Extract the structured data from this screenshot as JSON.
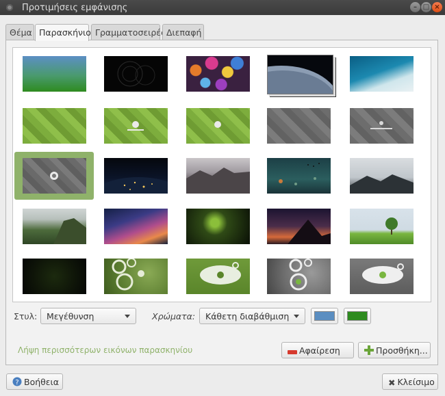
{
  "window": {
    "title": "Προτιμήσεις εμφάνισης",
    "buttons": [
      "minimize",
      "maximize",
      "close"
    ]
  },
  "tabs": [
    {
      "label": "Θέμα",
      "active": false
    },
    {
      "label": "Παρασκήνιο",
      "active": true
    },
    {
      "label": "Γραμματοσειρές",
      "active": false
    },
    {
      "label": "Διεπαφή",
      "active": false
    }
  ],
  "gallery": {
    "selected_index": 10,
    "thumbnails": [
      {
        "name": "blue-green-gradient"
      },
      {
        "name": "dark-circles"
      },
      {
        "name": "bokeh-lights"
      },
      {
        "name": "planet-earth-horizon"
      },
      {
        "name": "ocean-waves-aerial"
      },
      {
        "name": "green-cubes"
      },
      {
        "name": "green-cubes-ubuntu-mate-logo"
      },
      {
        "name": "green-cubes-mate-logo"
      },
      {
        "name": "grey-cubes"
      },
      {
        "name": "grey-cubes-ubuntu-mate-logo"
      },
      {
        "name": "grey-cubes-mate-logo"
      },
      {
        "name": "earth-night-lights"
      },
      {
        "name": "yosemite-valley"
      },
      {
        "name": "rainy-window-birds"
      },
      {
        "name": "misty-mountain"
      },
      {
        "name": "green-highlands"
      },
      {
        "name": "milky-way-lake"
      },
      {
        "name": "green-abstract-swirl"
      },
      {
        "name": "purple-sunset-mountain"
      },
      {
        "name": "lone-tree-field"
      },
      {
        "name": "dark-green-texture"
      },
      {
        "name": "green-circles-left"
      },
      {
        "name": "green-circles-splash"
      },
      {
        "name": "grey-circles-left"
      },
      {
        "name": "grey-circles-splash"
      }
    ]
  },
  "controls": {
    "style_label": "Στυλ:",
    "style_value": "Μεγέθυνση",
    "colors_label": "Χρώματα:",
    "colors_value": "Κάθετη διαβάθμιση",
    "primary_color": "#5b8ec1",
    "secondary_color": "#2e8b1f"
  },
  "more_link": "Λήψη περισσότερων εικόνων παρασκηνίου",
  "buttons": {
    "remove": "Αφαίρεση",
    "add": "Προσθήκη...",
    "help": "Βοήθεια",
    "close": "Κλείσιμο"
  },
  "colors": {
    "accent": "#8fb26a",
    "titlebar": "#3d3d3d",
    "close_button": "#e95420"
  }
}
